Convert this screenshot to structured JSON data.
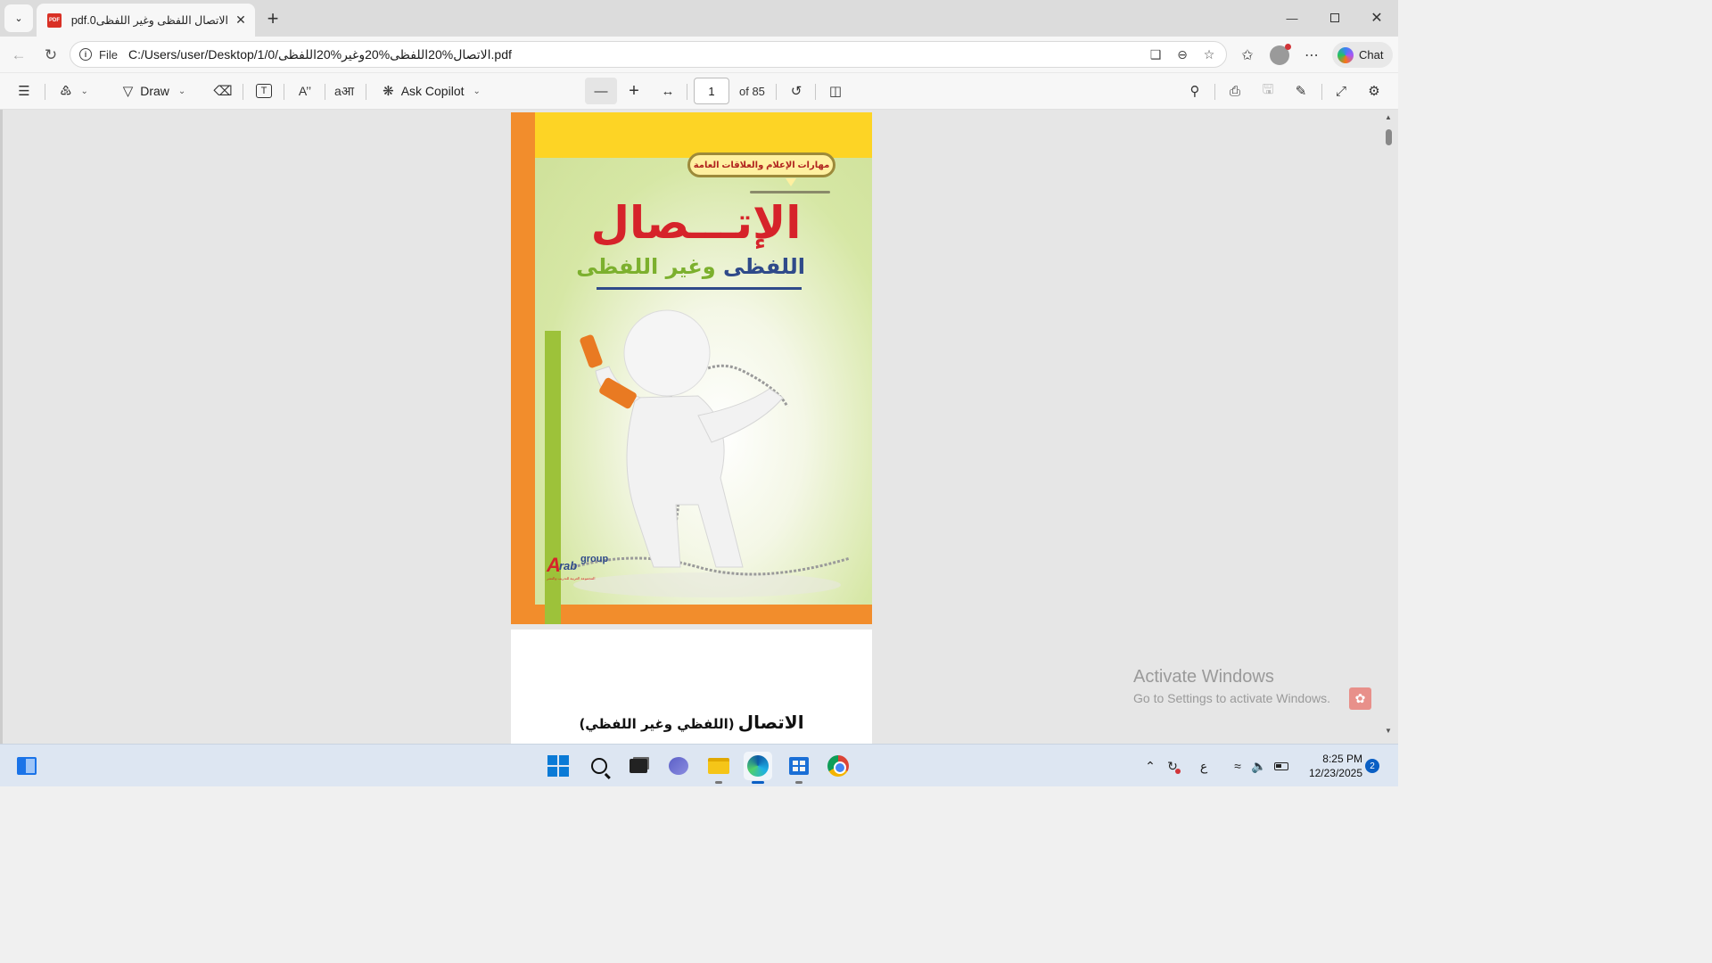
{
  "tab": {
    "title": "الاتصال اللفظى وغير اللفظى0.pdf",
    "pdf_badge": "PDF"
  },
  "address": {
    "scheme_label": "File",
    "url": "C:/Users/user/Desktop/1/0/الاتصال%20اللفظى%20وغير%20اللفظى.pdf"
  },
  "toolbar": {
    "draw_label": "Draw",
    "ask_copilot_label": "Ask Copilot",
    "page_number": "1",
    "page_of": "of 85",
    "chat_label": "Chat"
  },
  "cover": {
    "badge": "مهارات الإعلام والعلاقات العامة",
    "title": "الإتـــصال",
    "subtitle_part1": "اللفظى",
    "subtitle_part2": "وغير اللفظى",
    "logo_a": "A",
    "logo_rab": "rab",
    "logo_group": "group",
    "logo_tagline": "المجموعة العربية للتدريب والنشر",
    "colors": {
      "yellow": "#fdd425",
      "orange": "#f28d2c",
      "green": "#9dc23a",
      "red": "#d6232a",
      "blue": "#2f4a8a"
    }
  },
  "page2": {
    "title_big": "الاتصال",
    "title_small": "(اللفظي وغير اللفظي)"
  },
  "watermark": {
    "line1": "Activate Windows",
    "line2": "Go to Settings to activate Windows."
  },
  "taskbar": {
    "ime": "ع",
    "time": "8:25 PM",
    "date": "12/23/2025",
    "notifications": "2"
  }
}
